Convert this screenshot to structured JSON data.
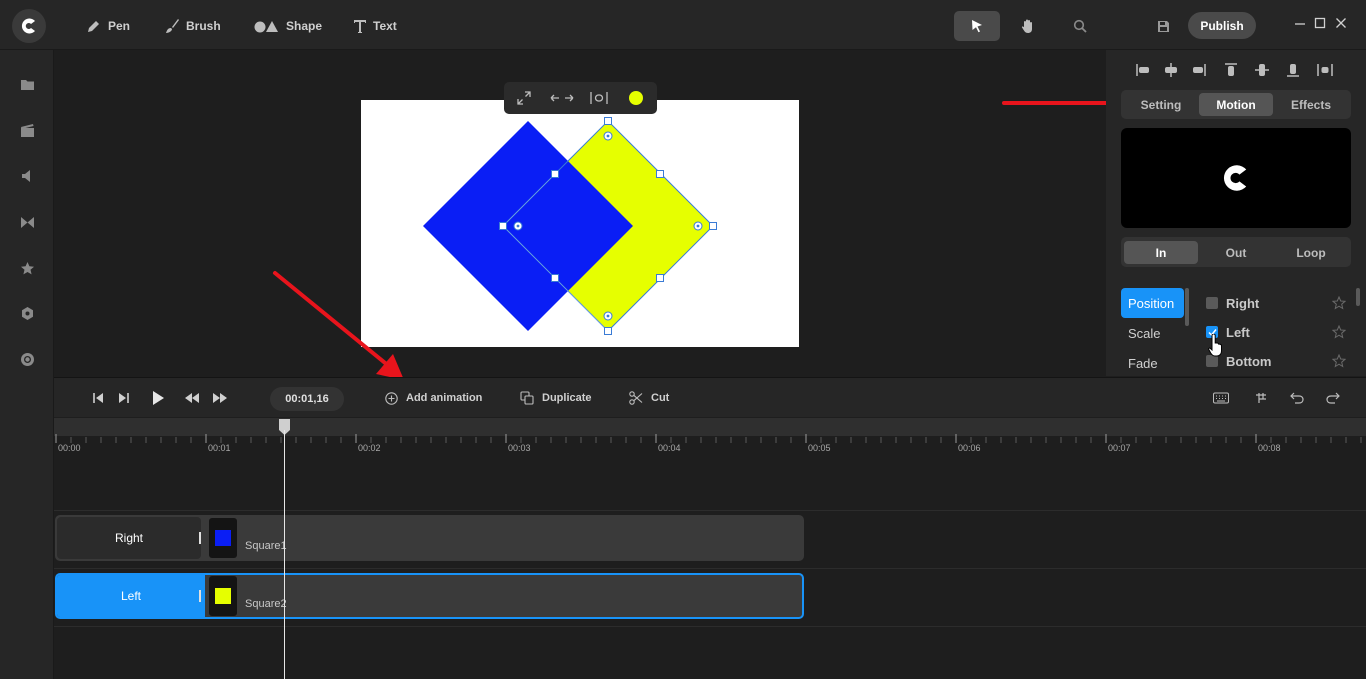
{
  "top_tools": [
    {
      "label": "Pen",
      "icon": "pen-icon"
    },
    {
      "label": "Brush",
      "icon": "brush-icon"
    },
    {
      "label": "Shape",
      "icon": "shape-icon"
    },
    {
      "label": "Text",
      "icon": "text-icon"
    }
  ],
  "publish_label": "Publish",
  "right_panel": {
    "tabs": [
      "Setting",
      "Motion",
      "Effects"
    ],
    "active_tab": "Motion",
    "anim_tabs": [
      "In",
      "Out",
      "Loop"
    ],
    "active_anim_tab": "In",
    "categories": [
      "Position",
      "Scale",
      "Fade"
    ],
    "active_category": "Position",
    "options": [
      {
        "label": "Right",
        "checked": false
      },
      {
        "label": "Left",
        "checked": true
      },
      {
        "label": "Bottom",
        "checked": false
      }
    ]
  },
  "timeline": {
    "timecode": "00:01,16",
    "actions": {
      "add_animation": "Add animation",
      "duplicate": "Duplicate",
      "cut": "Cut"
    },
    "ruler_labels": [
      "00:00",
      "00:01",
      "00:02",
      "00:03",
      "00:04",
      "00:05",
      "00:06",
      "00:07",
      "00:08"
    ],
    "tracks": [
      {
        "label": "Right",
        "clip": "Square1",
        "color": "#0a1ef5",
        "selected": false
      },
      {
        "label": "Left",
        "clip": "Square2",
        "color": "#e6ff00",
        "selected": true
      }
    ]
  },
  "colors": {
    "accent": "#1893f8",
    "square_blue": "#0a1ef5",
    "square_yellow": "#e6ff00",
    "annotation_arrow": "#e8141c"
  }
}
